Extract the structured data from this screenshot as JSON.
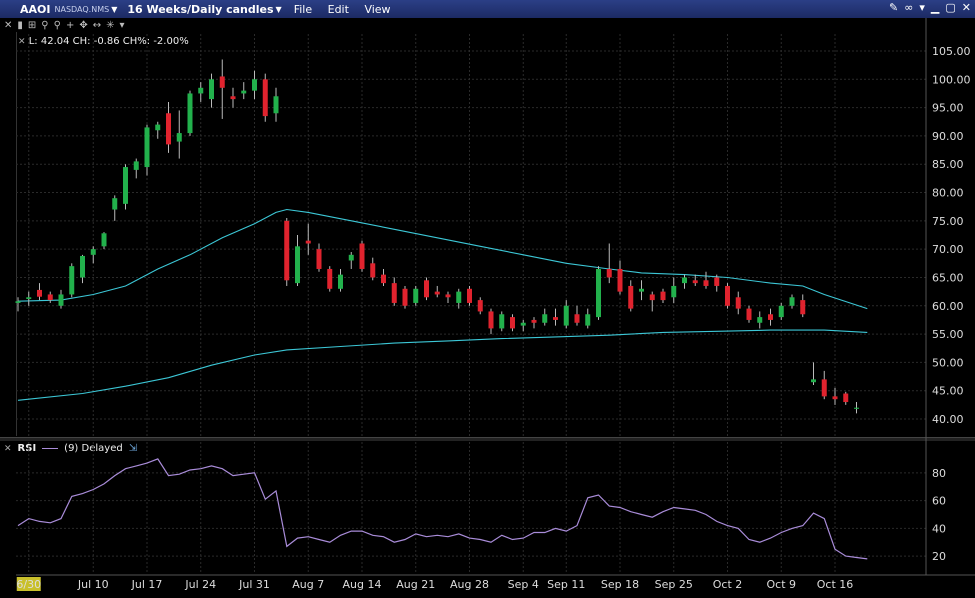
{
  "header": {
    "ticker": "AAOI",
    "exchange": "NASDAQ.NMS",
    "period": "16 Weeks/Daily candles",
    "menu": [
      "File",
      "Edit",
      "View"
    ]
  },
  "info": {
    "text": "L: 42.04 CH: -0.86 CH%: -2.00%"
  },
  "rsi": {
    "label": "RSI",
    "params": "(9) Delayed"
  },
  "chart_data": [
    {
      "type": "candlestick",
      "ylim": [
        37,
        108
      ],
      "yticks": [
        40,
        45,
        50,
        55,
        60,
        65,
        70,
        75,
        80,
        85,
        90,
        95,
        100,
        105
      ],
      "x_labels": [
        {
          "label": "6/30",
          "index": 1
        },
        {
          "label": "Jul 10",
          "index": 7
        },
        {
          "label": "Jul 17",
          "index": 12
        },
        {
          "label": "Jul 24",
          "index": 17
        },
        {
          "label": "Jul 31",
          "index": 22
        },
        {
          "label": "Aug 7",
          "index": 27
        },
        {
          "label": "Aug 14",
          "index": 32
        },
        {
          "label": "Aug 21",
          "index": 37
        },
        {
          "label": "Aug 28",
          "index": 42
        },
        {
          "label": "Sep 4",
          "index": 47
        },
        {
          "label": "Sep 11",
          "index": 51
        },
        {
          "label": "Sep 18",
          "index": 56
        },
        {
          "label": "Sep 25",
          "index": 61
        },
        {
          "label": "Oct 2",
          "index": 66
        },
        {
          "label": "Oct 9",
          "index": 71
        },
        {
          "label": "Oct 16",
          "index": 76
        }
      ],
      "candles": [
        {
          "o": 60.5,
          "h": 61.5,
          "l": 59.0,
          "c": 60.8
        },
        {
          "o": 61.2,
          "h": 62.5,
          "l": 60.0,
          "c": 61.5
        },
        {
          "o": 62.8,
          "h": 64.0,
          "l": 61.0,
          "c": 61.6
        },
        {
          "o": 62.0,
          "h": 62.5,
          "l": 60.5,
          "c": 61.0
        },
        {
          "o": 60.0,
          "h": 62.8,
          "l": 59.5,
          "c": 62.0
        },
        {
          "o": 62.0,
          "h": 67.5,
          "l": 61.5,
          "c": 67.0
        },
        {
          "o": 65.0,
          "h": 69.0,
          "l": 64.0,
          "c": 68.8
        },
        {
          "o": 69.0,
          "h": 70.5,
          "l": 67.5,
          "c": 70.0
        },
        {
          "o": 70.5,
          "h": 73.0,
          "l": 70.0,
          "c": 72.8
        },
        {
          "o": 77.0,
          "h": 79.5,
          "l": 75.0,
          "c": 79.0
        },
        {
          "o": 78.0,
          "h": 85.0,
          "l": 77.0,
          "c": 84.5
        },
        {
          "o": 84.0,
          "h": 86.0,
          "l": 82.5,
          "c": 85.5
        },
        {
          "o": 84.5,
          "h": 92.0,
          "l": 83.0,
          "c": 91.5
        },
        {
          "o": 91.0,
          "h": 92.5,
          "l": 89.5,
          "c": 92.0
        },
        {
          "o": 94.0,
          "h": 96.0,
          "l": 87.0,
          "c": 88.5
        },
        {
          "o": 89.0,
          "h": 94.5,
          "l": 86.0,
          "c": 90.5
        },
        {
          "o": 90.5,
          "h": 98.0,
          "l": 90.0,
          "c": 97.5
        },
        {
          "o": 97.5,
          "h": 99.5,
          "l": 96.0,
          "c": 98.5
        },
        {
          "o": 96.5,
          "h": 101.0,
          "l": 95.0,
          "c": 100.0
        },
        {
          "o": 100.5,
          "h": 103.5,
          "l": 93.0,
          "c": 98.5
        },
        {
          "o": 97.0,
          "h": 98.5,
          "l": 95.0,
          "c": 96.5
        },
        {
          "o": 97.5,
          "h": 99.5,
          "l": 96.5,
          "c": 98.0
        },
        {
          "o": 98.0,
          "h": 101.5,
          "l": 96.5,
          "c": 100.0
        },
        {
          "o": 100.0,
          "h": 101.0,
          "l": 92.5,
          "c": 93.5
        },
        {
          "o": 94.0,
          "h": 98.5,
          "l": 92.5,
          "c": 97.0
        },
        {
          "o": 75.0,
          "h": 75.5,
          "l": 63.5,
          "c": 64.5
        },
        {
          "o": 64.0,
          "h": 72.5,
          "l": 63.5,
          "c": 70.5
        },
        {
          "o": 71.5,
          "h": 74.5,
          "l": 69.0,
          "c": 71.0
        },
        {
          "o": 70.0,
          "h": 71.0,
          "l": 66.0,
          "c": 66.5
        },
        {
          "o": 66.5,
          "h": 67.0,
          "l": 62.5,
          "c": 63.0
        },
        {
          "o": 63.0,
          "h": 66.5,
          "l": 62.5,
          "c": 65.5
        },
        {
          "o": 68.0,
          "h": 69.5,
          "l": 66.5,
          "c": 69.0
        },
        {
          "o": 71.0,
          "h": 71.5,
          "l": 66.0,
          "c": 66.5
        },
        {
          "o": 67.5,
          "h": 68.5,
          "l": 64.5,
          "c": 65.0
        },
        {
          "o": 65.5,
          "h": 66.5,
          "l": 63.5,
          "c": 64.0
        },
        {
          "o": 64.0,
          "h": 65.0,
          "l": 60.0,
          "c": 60.5
        },
        {
          "o": 63.0,
          "h": 63.5,
          "l": 59.5,
          "c": 60.0
        },
        {
          "o": 60.5,
          "h": 63.5,
          "l": 60.0,
          "c": 63.0
        },
        {
          "o": 64.5,
          "h": 65.0,
          "l": 61.0,
          "c": 61.5
        },
        {
          "o": 62.5,
          "h": 63.5,
          "l": 61.5,
          "c": 62.0
        },
        {
          "o": 62.0,
          "h": 62.5,
          "l": 60.5,
          "c": 61.5
        },
        {
          "o": 60.5,
          "h": 63.0,
          "l": 59.5,
          "c": 62.5
        },
        {
          "o": 63.0,
          "h": 63.5,
          "l": 60.0,
          "c": 60.5
        },
        {
          "o": 61.0,
          "h": 61.5,
          "l": 58.5,
          "c": 59.0
        },
        {
          "o": 59.0,
          "h": 59.5,
          "l": 55.0,
          "c": 56.0
        },
        {
          "o": 56.0,
          "h": 59.0,
          "l": 55.5,
          "c": 58.5
        },
        {
          "o": 58.0,
          "h": 58.5,
          "l": 55.5,
          "c": 56.0
        },
        {
          "o": 56.5,
          "h": 57.5,
          "l": 55.5,
          "c": 57.0
        },
        {
          "o": 57.5,
          "h": 58.0,
          "l": 56.0,
          "c": 57.0
        },
        {
          "o": 57.0,
          "h": 59.5,
          "l": 56.5,
          "c": 58.5
        },
        {
          "o": 58.0,
          "h": 59.5,
          "l": 56.5,
          "c": 57.5
        },
        {
          "o": 56.5,
          "h": 61.0,
          "l": 56.0,
          "c": 60.0
        },
        {
          "o": 58.5,
          "h": 60.0,
          "l": 56.5,
          "c": 57.0
        },
        {
          "o": 56.5,
          "h": 59.5,
          "l": 56.0,
          "c": 58.5
        },
        {
          "o": 58.0,
          "h": 67.0,
          "l": 57.5,
          "c": 66.5
        },
        {
          "o": 66.5,
          "h": 71.0,
          "l": 64.0,
          "c": 65.0
        },
        {
          "o": 66.5,
          "h": 68.0,
          "l": 62.0,
          "c": 62.5
        },
        {
          "o": 63.5,
          "h": 64.5,
          "l": 59.0,
          "c": 59.5
        },
        {
          "o": 62.5,
          "h": 64.5,
          "l": 61.0,
          "c": 63.0
        },
        {
          "o": 62.0,
          "h": 62.5,
          "l": 59.0,
          "c": 61.0
        },
        {
          "o": 62.5,
          "h": 63.0,
          "l": 60.5,
          "c": 61.0
        },
        {
          "o": 61.5,
          "h": 65.0,
          "l": 60.5,
          "c": 63.5
        },
        {
          "o": 64.0,
          "h": 65.5,
          "l": 63.0,
          "c": 65.0
        },
        {
          "o": 64.5,
          "h": 65.5,
          "l": 63.5,
          "c": 64.0
        },
        {
          "o": 64.5,
          "h": 66.0,
          "l": 63.0,
          "c": 63.5
        },
        {
          "o": 65.0,
          "h": 65.5,
          "l": 62.5,
          "c": 63.5
        },
        {
          "o": 63.5,
          "h": 64.0,
          "l": 59.5,
          "c": 60.0
        },
        {
          "o": 61.5,
          "h": 62.5,
          "l": 58.5,
          "c": 59.5
        },
        {
          "o": 59.5,
          "h": 60.0,
          "l": 57.0,
          "c": 57.5
        },
        {
          "o": 57.0,
          "h": 59.0,
          "l": 56.0,
          "c": 58.0
        },
        {
          "o": 58.5,
          "h": 59.5,
          "l": 56.5,
          "c": 57.5
        },
        {
          "o": 58.0,
          "h": 60.5,
          "l": 57.5,
          "c": 60.0
        },
        {
          "o": 60.0,
          "h": 62.0,
          "l": 59.5,
          "c": 61.5
        },
        {
          "o": 61.0,
          "h": 62.0,
          "l": 58.0,
          "c": 58.5
        },
        {
          "o": 46.5,
          "h": 50.0,
          "l": 46.0,
          "c": 47.0
        },
        {
          "o": 47.0,
          "h": 48.5,
          "l": 43.5,
          "c": 44.0
        },
        {
          "o": 44.0,
          "h": 45.5,
          "l": 42.5,
          "c": 43.5
        },
        {
          "o": 44.5,
          "h": 44.8,
          "l": 42.5,
          "c": 43.0
        },
        {
          "o": 41.8,
          "h": 43.0,
          "l": 41.0,
          "c": 42.0
        }
      ],
      "ma_short": [
        {
          "i": 0,
          "v": 60.8
        },
        {
          "i": 4,
          "v": 61.0
        },
        {
          "i": 7,
          "v": 62.0
        },
        {
          "i": 10,
          "v": 63.5
        },
        {
          "i": 13,
          "v": 66.5
        },
        {
          "i": 16,
          "v": 69.0
        },
        {
          "i": 19,
          "v": 72.0
        },
        {
          "i": 22,
          "v": 74.5
        },
        {
          "i": 24,
          "v": 76.5
        },
        {
          "i": 25,
          "v": 77.0
        },
        {
          "i": 27,
          "v": 76.5
        },
        {
          "i": 31,
          "v": 75.0
        },
        {
          "i": 35,
          "v": 73.5
        },
        {
          "i": 39,
          "v": 72.0
        },
        {
          "i": 43,
          "v": 70.5
        },
        {
          "i": 47,
          "v": 69.0
        },
        {
          "i": 51,
          "v": 67.5
        },
        {
          "i": 55,
          "v": 66.5
        },
        {
          "i": 58,
          "v": 65.8
        },
        {
          "i": 62,
          "v": 65.5
        },
        {
          "i": 66,
          "v": 65.0
        },
        {
          "i": 70,
          "v": 64.0
        },
        {
          "i": 73,
          "v": 63.5
        },
        {
          "i": 75,
          "v": 62.0
        },
        {
          "i": 79,
          "v": 59.5
        }
      ],
      "ma_long": [
        {
          "i": 0,
          "v": 43.3
        },
        {
          "i": 6,
          "v": 44.5
        },
        {
          "i": 10,
          "v": 45.8
        },
        {
          "i": 14,
          "v": 47.3
        },
        {
          "i": 18,
          "v": 49.5
        },
        {
          "i": 22,
          "v": 51.3
        },
        {
          "i": 25,
          "v": 52.2
        },
        {
          "i": 30,
          "v": 52.8
        },
        {
          "i": 35,
          "v": 53.4
        },
        {
          "i": 40,
          "v": 53.8
        },
        {
          "i": 45,
          "v": 54.2
        },
        {
          "i": 50,
          "v": 54.5
        },
        {
          "i": 55,
          "v": 54.8
        },
        {
          "i": 60,
          "v": 55.3
        },
        {
          "i": 65,
          "v": 55.5
        },
        {
          "i": 70,
          "v": 55.7
        },
        {
          "i": 75,
          "v": 55.7
        },
        {
          "i": 79,
          "v": 55.3
        }
      ]
    },
    {
      "type": "line",
      "name": "RSI",
      "ylim": [
        10,
        95
      ],
      "yticks": [
        20,
        40,
        60,
        80
      ],
      "values": [
        42,
        47,
        45,
        44,
        47,
        63,
        65,
        68,
        72,
        78,
        83,
        85,
        87,
        90,
        78,
        79,
        82,
        83,
        85,
        83,
        78,
        79,
        80,
        61,
        67,
        27,
        33,
        34,
        32,
        30,
        35,
        38,
        38,
        35,
        34,
        30,
        32,
        36,
        34,
        35,
        34,
        36,
        33,
        32,
        30,
        35,
        32,
        33,
        37,
        37,
        40,
        38,
        42,
        62,
        64,
        56,
        55,
        52,
        50,
        48,
        52,
        55,
        54,
        53,
        50,
        45,
        42,
        40,
        32,
        30,
        33,
        37,
        40,
        42,
        51,
        47,
        25,
        20,
        19,
        18
      ]
    }
  ]
}
